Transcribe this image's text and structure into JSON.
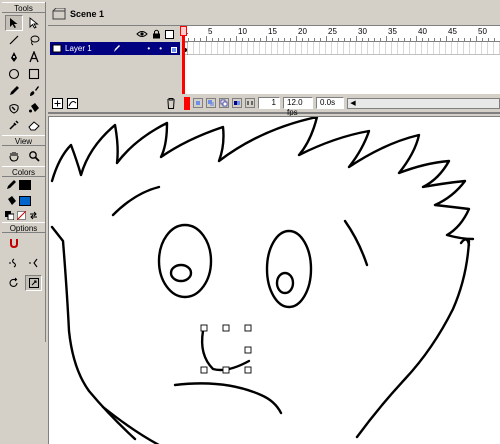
{
  "tools_panel": {
    "title": "Tools",
    "sections": {
      "view": "View",
      "colors": "Colors",
      "options": "Options"
    },
    "tools": [
      {
        "name": "arrow-icon",
        "active": true
      },
      {
        "name": "subselect-icon",
        "active": false
      },
      {
        "name": "line-icon",
        "active": false
      },
      {
        "name": "lasso-icon",
        "active": false
      },
      {
        "name": "pen-icon",
        "active": false
      },
      {
        "name": "text-icon",
        "active": false
      },
      {
        "name": "oval-icon",
        "active": false
      },
      {
        "name": "rectangle-icon",
        "active": false
      },
      {
        "name": "pencil-icon",
        "active": false
      },
      {
        "name": "brush-icon",
        "active": false
      },
      {
        "name": "ink-bottle-icon",
        "active": false
      },
      {
        "name": "paint-bucket-icon",
        "active": false
      },
      {
        "name": "eyedropper-icon",
        "active": false
      },
      {
        "name": "eraser-icon",
        "active": false
      }
    ],
    "colors": {
      "stroke": "#000000",
      "fill": "#0066cc"
    }
  },
  "scene": {
    "label": "Scene 1"
  },
  "timeline": {
    "layer_name": "Layer 1",
    "ruler_labels": [
      "1",
      "5",
      "10",
      "15",
      "20",
      "25",
      "30",
      "35",
      "40",
      "45",
      "50"
    ],
    "current_frame": "1",
    "frame_rate": "12.0 fps",
    "elapsed_time": "0.0s"
  },
  "colors": {
    "selection": "#000080",
    "playhead": "#ff0000",
    "stage": "#ffffff",
    "chrome": "#d4d0c8"
  }
}
